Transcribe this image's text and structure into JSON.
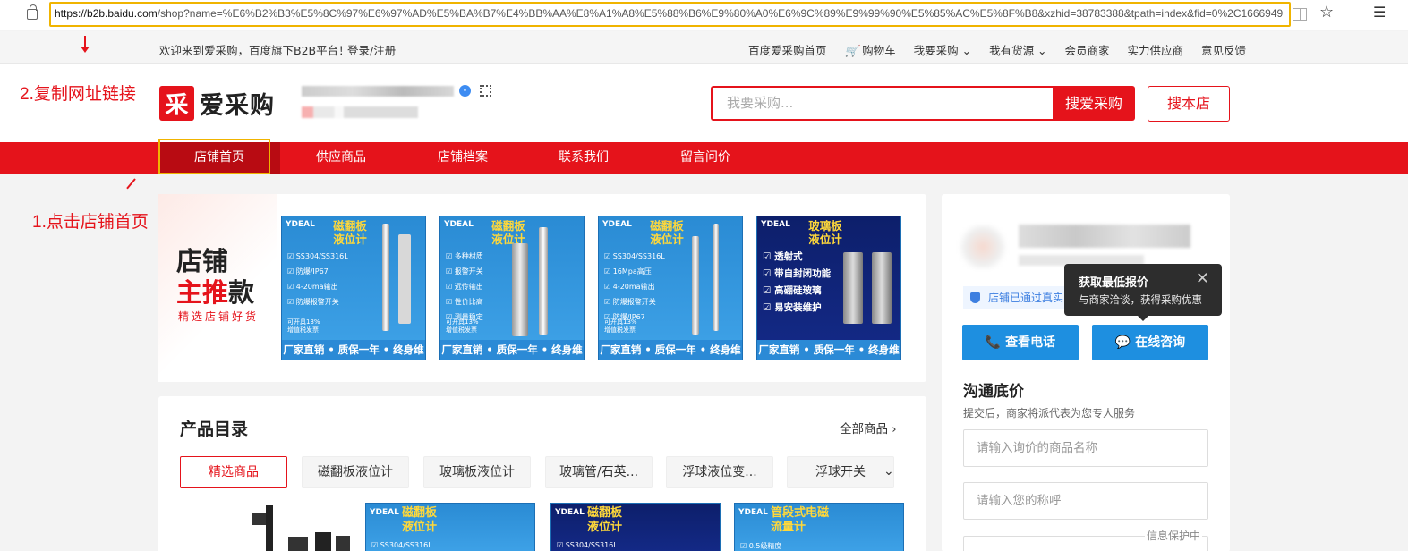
{
  "browser": {
    "url_host": "https://b2b.baidu.com",
    "url_rest": "/shop?name=%E6%B2%B3%E5%8C%97%E6%97%AD%E5%BA%B7%E4%BB%AA%E8%A1%A8%E5%88%B6%E9%80%A0%E6%9C%89%E9%99%90%E5%85%AC%E5%8F%B8&xzhid=38783388&tpath=index&fid=0%2C1666949"
  },
  "topnav": {
    "welcome": "欢迎来到爱采购，百度旗下B2B平台！",
    "login": "登录/注册",
    "links": [
      "百度爱采购首页",
      "购物车",
      "我要采购 ⌄",
      "我有货源 ⌄",
      "会员商家",
      "实力供应商",
      "意见反馈"
    ]
  },
  "header": {
    "logo_mark": "采",
    "logo_text": "爱采购",
    "search_placeholder": "我要采购...",
    "search_btn": "搜爱采购",
    "store_search_btn": "搜本店"
  },
  "rednav": {
    "items": [
      "店铺首页",
      "供应商品",
      "店铺档案",
      "联系我们",
      "留言问价"
    ]
  },
  "annotations": {
    "step2": "2.复制网址链接",
    "step1": "1.点击店铺首页"
  },
  "banner": {
    "title1": "店铺",
    "title2a": "主推",
    "title2b": "款",
    "sub": "精选店铺好货",
    "footer": "厂家直销 • 质保一年 • 终身维护",
    "products": [
      {
        "brand": "YDEAL",
        "title": "磁翻板\n液位计",
        "feats": [
          "☑ SS304/SS316L",
          "☑ 防爆/IP67",
          "☑ 4-20ma输出",
          "☑ 防爆报警开关"
        ],
        "vat": "可开具13%增值税发票"
      },
      {
        "brand": "YDEAL",
        "title": "磁翻板\n液位计",
        "feats": [
          "☑ 多种材质",
          "☑ 报警开关",
          "☑ 远传输出",
          "☑ 性价比高",
          "☑ 测量稳定"
        ],
        "vat": "可开具13%增值税发票"
      },
      {
        "brand": "YDEAL",
        "title": "磁翻板\n液位计",
        "feats": [
          "☑ SS304/SS316L",
          "☑ 16Mpa高压",
          "☑ 4-20ma输出",
          "☑ 防爆报警开关",
          "☑ 防爆/IP67"
        ],
        "vat": "可开具13%增值税发票"
      },
      {
        "brand": "YDEAL",
        "title": "玻璃板\n液位计",
        "feats": [
          "☑ 透射式",
          "☑ 带自封闭功能",
          "☑ 高硼硅玻璃",
          "☑ 易安装维护"
        ],
        "vat": ""
      }
    ]
  },
  "catalog": {
    "title": "产品目录",
    "all": "全部商品 ›",
    "tabs": [
      "精选商品",
      "磁翻板液位计",
      "玻璃板液位计",
      "玻璃管/石英...",
      "浮球液位变...",
      "浮球开关"
    ],
    "more": "⌄",
    "thumbs": [
      {
        "title": "磁翻板\n液位计",
        "spec": "☑ SS304/SS316L"
      },
      {
        "title": "磁翻板\n液位计",
        "spec": "☑ SS304/SS316L"
      },
      {
        "title": "管段式电磁\n流量计",
        "spec": "☑ 0.5级精度"
      }
    ]
  },
  "side": {
    "verify": "店铺已通过真实",
    "tooltip_title": "获取最低报价",
    "tooltip_body": "与商家洽谈，获得采购优惠",
    "tooltip_close": "✕",
    "btn_phone": "📞 查看电话",
    "btn_chat": "💬 在线咨询",
    "heading": "沟通底价",
    "desc": "提交后，商家将派代表为您专人服务",
    "input1_placeholder": "请输入询价的商品名称",
    "input2_placeholder": "请输入您的称呼",
    "privacy": "信息保护中"
  }
}
